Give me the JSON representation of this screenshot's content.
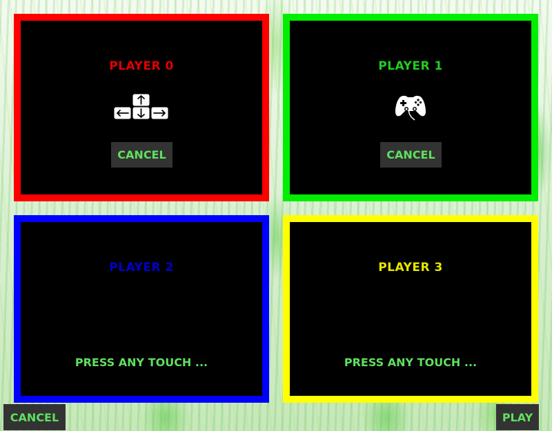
{
  "players": [
    {
      "title": "PLAYER 0",
      "cancel_label": "CANCEL",
      "device_icon": "arrow-keys-icon",
      "color": "#ff0000"
    },
    {
      "title": "PLAYER 1",
      "cancel_label": "CANCEL",
      "device_icon": "gamepad-icon",
      "color": "#00ee00"
    },
    {
      "title": "PLAYER 2",
      "prompt": "PRESS ANY TOUCH ...",
      "color": "#0000ff"
    },
    {
      "title": "PLAYER 3",
      "prompt": "PRESS ANY TOUCH ...",
      "color": "#ffff00"
    }
  ],
  "footer": {
    "cancel_label": "CANCEL",
    "play_label": "PLAY"
  }
}
